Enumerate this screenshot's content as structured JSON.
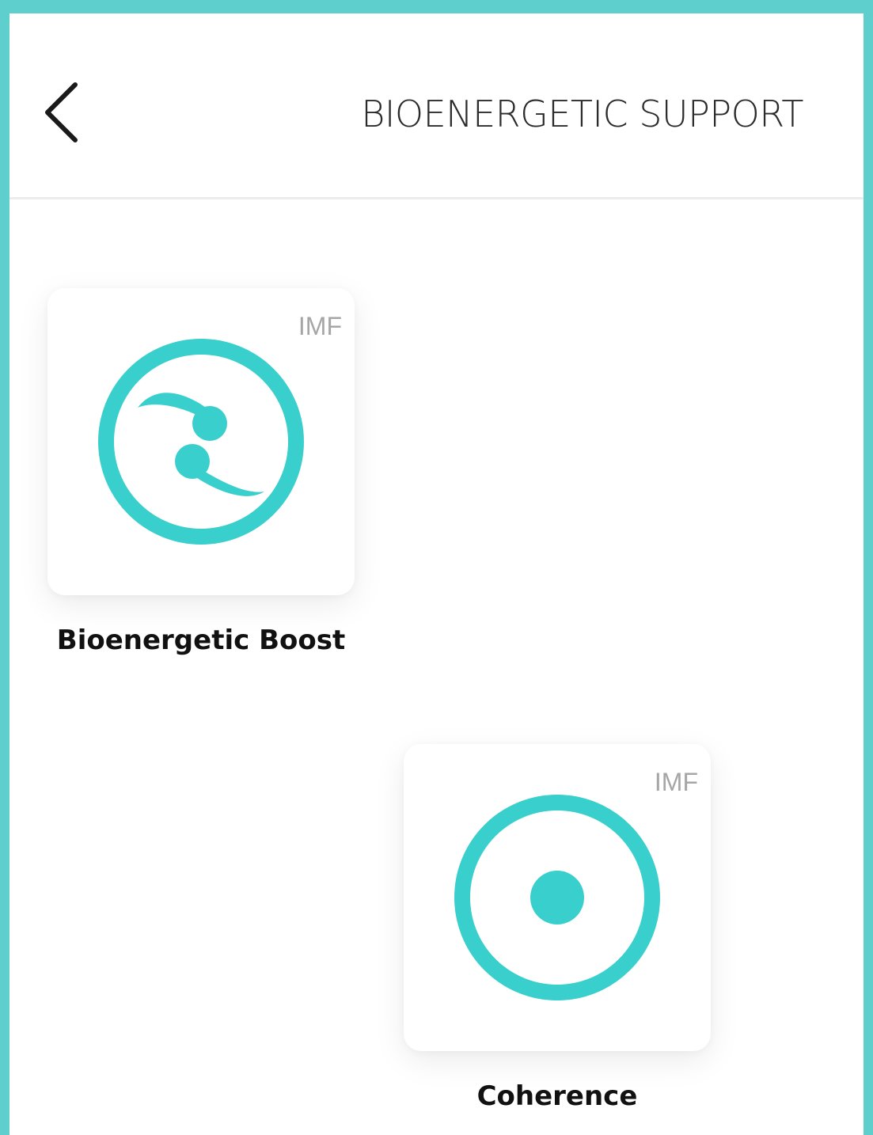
{
  "header": {
    "title": "BIOENERGETIC SUPPORT",
    "back_icon": "chevron-left-icon"
  },
  "programs": [
    {
      "label": "Bioenergetic Boost",
      "badge": "IMF",
      "icon": "bioenergetic-boost-icon"
    },
    {
      "label": "Coherence",
      "badge": "IMF",
      "icon": "coherence-icon"
    }
  ],
  "colors": {
    "accent": "#38cfcc",
    "frame": "#5ecfcc",
    "title_text": "#2b2b2b",
    "badge_text": "#a6a6a6"
  }
}
